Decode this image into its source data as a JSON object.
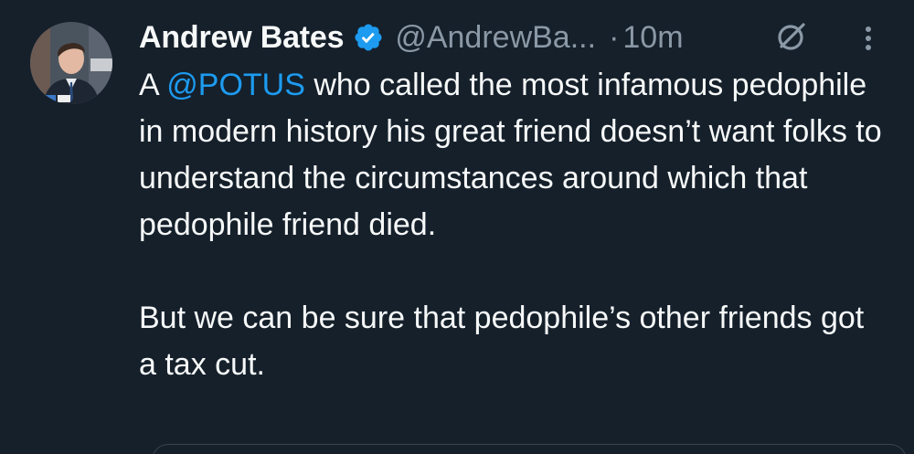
{
  "tweet": {
    "author": {
      "display_name": "Andrew Bates",
      "handle": "@AndrewBa...",
      "verified": true
    },
    "separator": "·",
    "timestamp": "10m",
    "body": {
      "line1_prefix": "A ",
      "mention": "@POTUS",
      "line1_rest": " who called the most infamous pedophile in modern history his great friend doesn’t want folks to understand the circumstances around which that pedophile friend died.",
      "paragraph2": "But we can be sure that pedophile’s other friends got a tax cut."
    },
    "icons": {
      "verified": "verified-badge-icon",
      "grok": "grok-icon",
      "more": "more-options-icon"
    }
  },
  "colors": {
    "background": "#15202b",
    "text": "#f7f9f9",
    "muted": "#8b98a5",
    "accent": "#1d9bf0",
    "border": "#38444d"
  }
}
